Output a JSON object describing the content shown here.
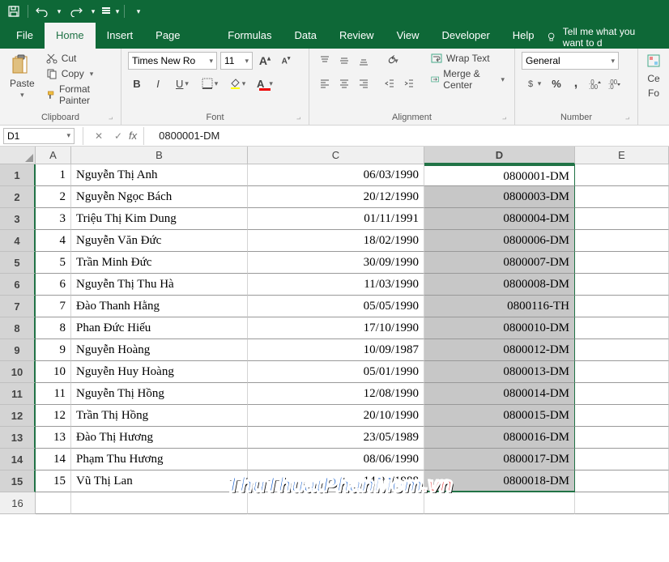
{
  "qat": {
    "save": "Save",
    "undo": "Undo",
    "redo": "Redo",
    "custom": "Customize"
  },
  "tabs": [
    "File",
    "Home",
    "Insert",
    "Page Layout",
    "Formulas",
    "Data",
    "Review",
    "View",
    "Developer",
    "Help"
  ],
  "tell_me": "Tell me what you want to d",
  "clipboard": {
    "paste": "Paste",
    "cut": "Cut",
    "copy": "Copy",
    "painter": "Format Painter",
    "label": "Clipboard"
  },
  "font": {
    "name": "Times New Ro",
    "size": "11",
    "label": "Font"
  },
  "alignment": {
    "wrap": "Wrap Text",
    "merge": "Merge & Center",
    "label": "Alignment"
  },
  "number": {
    "format": "General",
    "label": "Number"
  },
  "cells_label": "Ce",
  "namebox": "D1",
  "formula_value": "0800001-DM",
  "columns": [
    "A",
    "B",
    "C",
    "D",
    "E"
  ],
  "rows": [
    {
      "n": 1,
      "a": "1",
      "b": "Nguyễn Thị Anh",
      "c": "06/03/1990",
      "d": "0800001-DM"
    },
    {
      "n": 2,
      "a": "2",
      "b": "Nguyễn Ngọc Bách",
      "c": "20/12/1990",
      "d": "0800003-DM"
    },
    {
      "n": 3,
      "a": "3",
      "b": "Triệu Thị Kim Dung",
      "c": "01/11/1991",
      "d": "0800004-DM"
    },
    {
      "n": 4,
      "a": "4",
      "b": "Nguyễn Văn Đức",
      "c": "18/02/1990",
      "d": "0800006-DM"
    },
    {
      "n": 5,
      "a": "5",
      "b": "Trần Minh Đức",
      "c": "30/09/1990",
      "d": "0800007-DM"
    },
    {
      "n": 6,
      "a": "6",
      "b": "Nguyễn Thị Thu Hà",
      "c": "11/03/1990",
      "d": "0800008-DM"
    },
    {
      "n": 7,
      "a": "7",
      "b": "Đào Thanh Hằng",
      "c": "05/05/1990",
      "d": "0800116-TH"
    },
    {
      "n": 8,
      "a": "8",
      "b": "Phan Đức Hiếu",
      "c": "17/10/1990",
      "d": "0800010-DM"
    },
    {
      "n": 9,
      "a": "9",
      "b": "Nguyễn Hoàng",
      "c": "10/09/1987",
      "d": "0800012-DM"
    },
    {
      "n": 10,
      "a": "10",
      "b": "Nguyễn Huy Hoàng",
      "c": "05/01/1990",
      "d": "0800013-DM"
    },
    {
      "n": 11,
      "a": "11",
      "b": "Nguyễn Thị Hồng",
      "c": "12/08/1990",
      "d": "0800014-DM"
    },
    {
      "n": 12,
      "a": "12",
      "b": "Trần Thị Hồng",
      "c": "20/10/1990",
      "d": "0800015-DM"
    },
    {
      "n": 13,
      "a": "13",
      "b": "Đào Thị Hương",
      "c": "23/05/1989",
      "d": "0800016-DM"
    },
    {
      "n": 14,
      "a": "14",
      "b": "Phạm Thu Hương",
      "c": "08/06/1990",
      "d": "0800017-DM"
    },
    {
      "n": 15,
      "a": "15",
      "b": "Vũ Thị Lan",
      "c": "14/07/1988",
      "d": "0800018-DM"
    }
  ],
  "watermark": {
    "t1": "ThuThuatPhanMem",
    "t2": ".vn"
  }
}
